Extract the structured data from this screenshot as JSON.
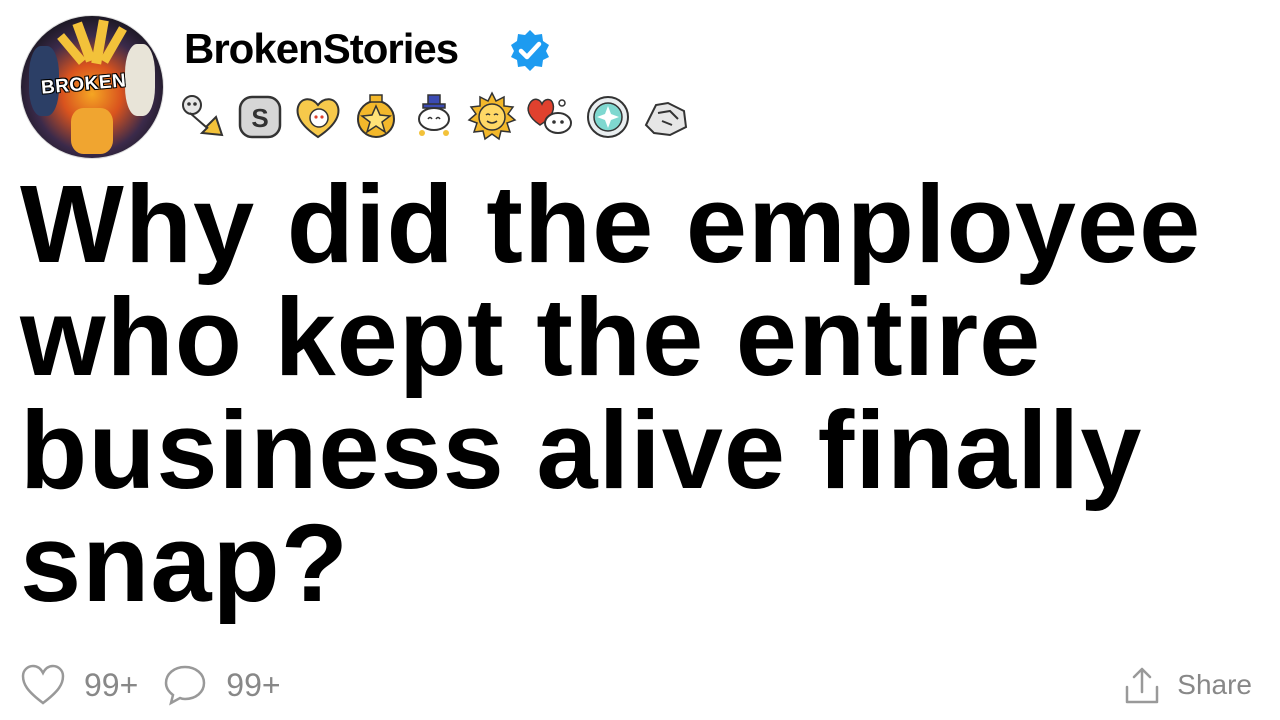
{
  "post": {
    "avatar_label": "BROKEN",
    "username": "BrokenStories",
    "verified_icon": "verified-badge-icon",
    "awards": [
      "bugle-award-icon",
      "silver-award-icon",
      "heart-snoo-award-icon",
      "gold-star-award-icon",
      "top-hat-snoo-award-icon",
      "sun-award-icon",
      "heart-balloon-snoo-award-icon",
      "platinum-gem-award-icon",
      "handshake-award-icon"
    ],
    "title": "Why did the employee who kept the entire business alive finally snap?"
  },
  "actions": {
    "likes": "99+",
    "comments": "99+",
    "share_label": "Share"
  },
  "colors": {
    "verified": "#1d9bf0",
    "action_gray": "#888888"
  }
}
